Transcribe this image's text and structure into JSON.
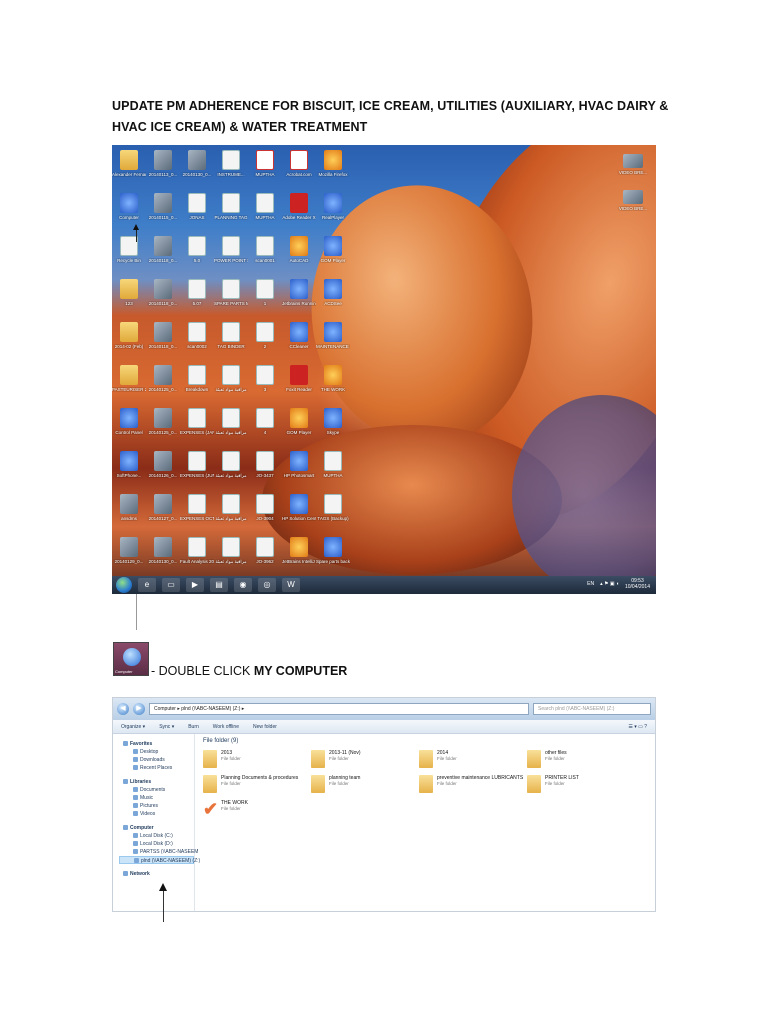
{
  "doc": {
    "title": "UPDATE PM ADHERENCE FOR BISCUIT, ICE CREAM, UTILITIES (AUXILIARY, HVAC DAIRY & HVAC ICE CREAM) & WATER TREATMENT",
    "instruction_prefix": "- DOUBLE CLICK ",
    "instruction_bold": "MY COMPUTER"
  },
  "desktop": {
    "icons": [
      {
        "label": "Alexander Fernandez",
        "kind": "folder"
      },
      {
        "label": "20140113_0...",
        "kind": "img"
      },
      {
        "label": "20140130_0...",
        "kind": "img"
      },
      {
        "label": "INSTRUME...",
        "kind": "doc"
      },
      {
        "label": "MUPTHA",
        "kind": "pdf"
      },
      {
        "label": "Acrobat.com",
        "kind": "pdf"
      },
      {
        "label": "Mozilla Firefox",
        "kind": "orange"
      },
      {
        "label": "Computer",
        "kind": "blue"
      },
      {
        "label": "20140115_0...",
        "kind": "img"
      },
      {
        "label": "JONAS",
        "kind": "doc"
      },
      {
        "label": "PLANNING TAG",
        "kind": "doc"
      },
      {
        "label": "MUPTHA",
        "kind": "doc"
      },
      {
        "label": "Adobe Reader X",
        "kind": "red"
      },
      {
        "label": "RealPlayer",
        "kind": "blue"
      },
      {
        "label": "Recycle Bin",
        "kind": "doc"
      },
      {
        "label": "20140118_0...",
        "kind": "img"
      },
      {
        "label": "5.0",
        "kind": "doc"
      },
      {
        "label": "POWER POINT SC...",
        "kind": "doc"
      },
      {
        "label": "scan0001",
        "kind": "doc"
      },
      {
        "label": "AutoCAD",
        "kind": "orange"
      },
      {
        "label": "GOM Player",
        "kind": "blue"
      },
      {
        "label": "123",
        "kind": "folder"
      },
      {
        "label": "20140118_0...",
        "kind": "img"
      },
      {
        "label": "5.07",
        "kind": "doc"
      },
      {
        "label": "SPARE PARTS MKDB",
        "kind": "doc"
      },
      {
        "label": "1",
        "kind": "doc"
      },
      {
        "label": "Jetbrains Running...",
        "kind": "blue"
      },
      {
        "label": "ACDSee",
        "kind": "blue"
      },
      {
        "label": "2014-02 (Feb)",
        "kind": "folder"
      },
      {
        "label": "20140118_0...",
        "kind": "img"
      },
      {
        "label": "scan0002",
        "kind": "doc"
      },
      {
        "label": "TAG BINDER",
        "kind": "doc"
      },
      {
        "label": "2",
        "kind": "doc"
      },
      {
        "label": "CCleaner",
        "kind": "blue"
      },
      {
        "label": "MAINTENANCE SHARED",
        "kind": "blue"
      },
      {
        "label": "PASTEURISER 20000 (Back)",
        "kind": "folder"
      },
      {
        "label": "20140125_0...",
        "kind": "img"
      },
      {
        "label": "Breakdown",
        "kind": "doc"
      },
      {
        "label": "مراقبة مواد تعبئة",
        "kind": "doc"
      },
      {
        "label": "3",
        "kind": "doc"
      },
      {
        "label": "Foxit Reader",
        "kind": "red"
      },
      {
        "label": "THE WORK",
        "kind": "orange"
      },
      {
        "label": "Control Panel",
        "kind": "blue"
      },
      {
        "label": "20140125_0...",
        "kind": "img"
      },
      {
        "label": "EXPENSES (JANUARY...",
        "kind": "doc"
      },
      {
        "label": "مراقبة مواد تعبئة",
        "kind": "doc"
      },
      {
        "label": "4",
        "kind": "doc"
      },
      {
        "label": "GOM Player",
        "kind": "orange"
      },
      {
        "label": "Skype",
        "kind": "blue"
      },
      {
        "label": "SoftPhone...",
        "kind": "blue"
      },
      {
        "label": "20140126_0...",
        "kind": "img"
      },
      {
        "label": "EXPENSES (JUNE-DE...",
        "kind": "doc"
      },
      {
        "label": "مراقبة مواد تعبئة",
        "kind": "doc"
      },
      {
        "label": "JO-3437",
        "kind": "doc"
      },
      {
        "label": "HP Photosmart",
        "kind": "blue"
      },
      {
        "label": "MUPTHA",
        "kind": "doc"
      },
      {
        "label": "ansdms",
        "kind": "img"
      },
      {
        "label": "20140127_0...",
        "kind": "img"
      },
      {
        "label": "EXPENSES OCT-DE...",
        "kind": "doc"
      },
      {
        "label": "مراقبة مواد تعبئة",
        "kind": "doc"
      },
      {
        "label": "JO-3904",
        "kind": "doc"
      },
      {
        "label": "HP Solution Center",
        "kind": "blue"
      },
      {
        "label": "TAGS (Backup)",
        "kind": "doc"
      },
      {
        "label": "20140129_0...",
        "kind": "img"
      },
      {
        "label": "20140130_0...",
        "kind": "img"
      },
      {
        "label": "Fault Analysis 2013",
        "kind": "doc"
      },
      {
        "label": "مراقبة مواد تعبئة",
        "kind": "doc"
      },
      {
        "label": "JO-3962",
        "kind": "doc"
      },
      {
        "label": "JetBrains IntelliJ Edition",
        "kind": "orange"
      },
      {
        "label": "Spare parts backup",
        "kind": "blue"
      }
    ],
    "right_icons": [
      {
        "label": "VIDEO BRE..."
      },
      {
        "label": "VIDEO BRE..."
      }
    ],
    "taskbar": {
      "language": "EN",
      "time": "09:53",
      "date": "10/04/2014"
    }
  },
  "instruction_icon_caption": "Computer",
  "explorer": {
    "address": "Computer  ▸  plnd (\\\\ABC-NASEEM) (Z:)  ▸",
    "search_placeholder": "Search plnd (\\\\ABC-NASEEM) (Z:)",
    "toolbar": [
      "Organize ▾",
      "Sync ▾",
      "Burn",
      "Work offline",
      "New folder"
    ],
    "nav": [
      {
        "label": "Favorites",
        "level": "head"
      },
      {
        "label": "Desktop",
        "level": "sub"
      },
      {
        "label": "Downloads",
        "level": "sub"
      },
      {
        "label": "Recent Places",
        "level": "sub"
      },
      {
        "label": "Libraries",
        "level": "head"
      },
      {
        "label": "Documents",
        "level": "sub"
      },
      {
        "label": "Music",
        "level": "sub"
      },
      {
        "label": "Pictures",
        "level": "sub"
      },
      {
        "label": "Videos",
        "level": "sub"
      },
      {
        "label": "Computer",
        "level": "head"
      },
      {
        "label": "Local Disk (C:)",
        "level": "sub"
      },
      {
        "label": "Local Disk (D:)",
        "level": "sub"
      },
      {
        "label": "PARTSS (\\\\ABC-NASEEM",
        "level": "sub"
      },
      {
        "label": "plnd (\\\\ABC-NASEEM) (Z:)",
        "level": "sub",
        "selected": true
      },
      {
        "label": "Network",
        "level": "head"
      }
    ],
    "group_header": "File folder (9)",
    "folders": [
      {
        "name": "2013",
        "type": "File folder"
      },
      {
        "name": "2013-11 (Nov)",
        "type": "File folder"
      },
      {
        "name": "2014",
        "type": "File folder"
      },
      {
        "name": "other files",
        "type": "File folder"
      },
      {
        "name": "Planning Documents & procedures",
        "type": "File folder"
      },
      {
        "name": "planning team",
        "type": "File folder"
      },
      {
        "name": "preventive maintenance LUBRICANTS",
        "type": "File folder"
      },
      {
        "name": "PRINTER LIST",
        "type": "File folder"
      },
      {
        "name": "THE WORK",
        "type": "File folder",
        "icon": "check"
      }
    ]
  }
}
